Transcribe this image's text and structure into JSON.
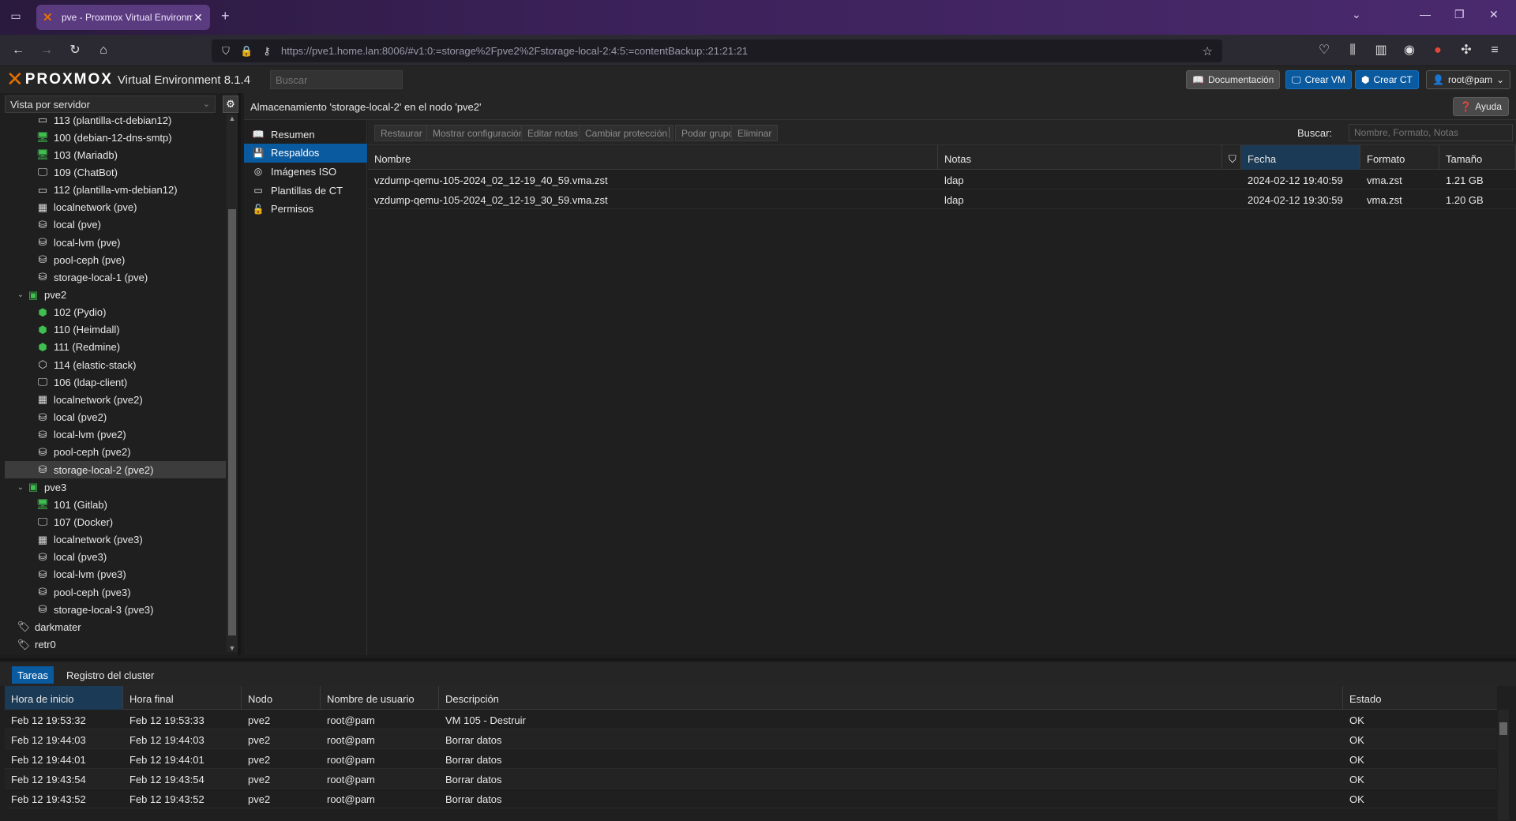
{
  "browser": {
    "tab_title": "pve - Proxmox Virtual Environment",
    "url": "https://pve1.home.lan:8006/#v1:0:=storage%2Fpve2%2Fstorage-local-2:4:5:=contentBackup::21:21:21"
  },
  "pve": {
    "brand": "PROXMOX",
    "version": "Virtual Environment 8.1.4",
    "search_placeholder": "Buscar",
    "docs": "Documentación",
    "create_vm": "Crear VM",
    "create_ct": "Crear CT",
    "user": "root@pam"
  },
  "tree": {
    "view": "Vista por servidor",
    "nodes": [
      {
        "label": "113 (plantilla-ct-debian12)",
        "icon": "template-icon",
        "sym": "▭",
        "indent": 2
      },
      {
        "label": "100 (debian-12-dns-smtp)",
        "icon": "vm-running-icon",
        "sym": "🖥",
        "indent": 2
      },
      {
        "label": "103 (Mariadb)",
        "icon": "vm-running-icon",
        "sym": "🖥",
        "indent": 2
      },
      {
        "label": "109 (ChatBot)",
        "icon": "vm-stopped-icon",
        "sym": "🖵",
        "indent": 2
      },
      {
        "label": "112 (plantilla-vm-debian12)",
        "icon": "template-icon",
        "sym": "▭",
        "indent": 2
      },
      {
        "label": "localnetwork (pve)",
        "icon": "network-grid-icon",
        "sym": "▦",
        "indent": 2
      },
      {
        "label": "local (pve)",
        "icon": "storage-icon",
        "sym": "⛁",
        "indent": 2
      },
      {
        "label": "local-lvm (pve)",
        "icon": "storage-icon",
        "sym": "⛁",
        "indent": 2
      },
      {
        "label": "pool-ceph (pve)",
        "icon": "storage-icon",
        "sym": "⛁",
        "indent": 2
      },
      {
        "label": "storage-local-1 (pve)",
        "icon": "storage-icon",
        "sym": "⛁",
        "indent": 2
      },
      {
        "label": "pve2",
        "icon": "node-online-icon",
        "sym": "▣",
        "indent": 1,
        "exp": "⌄"
      },
      {
        "label": "102 (Pydio)",
        "icon": "container-running-icon",
        "sym": "⬢",
        "indent": 2
      },
      {
        "label": "110 (Heimdall)",
        "icon": "container-running-icon",
        "sym": "⬢",
        "indent": 2
      },
      {
        "label": "111 (Redmine)",
        "icon": "container-running-icon",
        "sym": "⬢",
        "indent": 2
      },
      {
        "label": "114 (elastic-stack)",
        "icon": "container-stopped-icon",
        "sym": "⬡",
        "indent": 2
      },
      {
        "label": "106 (ldap-client)",
        "icon": "vm-stopped-icon",
        "sym": "🖵",
        "indent": 2
      },
      {
        "label": "localnetwork (pve2)",
        "icon": "network-grid-icon",
        "sym": "▦",
        "indent": 2
      },
      {
        "label": "local (pve2)",
        "icon": "storage-icon",
        "sym": "⛁",
        "indent": 2
      },
      {
        "label": "local-lvm (pve2)",
        "icon": "storage-icon",
        "sym": "⛁",
        "indent": 2
      },
      {
        "label": "pool-ceph (pve2)",
        "icon": "storage-icon",
        "sym": "⛁",
        "indent": 2
      },
      {
        "label": "storage-local-2 (pve2)",
        "icon": "storage-icon",
        "sym": "⛁",
        "indent": 2,
        "selected": true
      },
      {
        "label": "pve3",
        "icon": "node-online-icon",
        "sym": "▣",
        "indent": 1,
        "exp": "⌄"
      },
      {
        "label": "101 (Gitlab)",
        "icon": "vm-running-icon",
        "sym": "🖥",
        "indent": 2
      },
      {
        "label": "107 (Docker)",
        "icon": "vm-stopped-icon",
        "sym": "🖵",
        "indent": 2
      },
      {
        "label": "localnetwork (pve3)",
        "icon": "network-grid-icon",
        "sym": "▦",
        "indent": 2
      },
      {
        "label": "local (pve3)",
        "icon": "storage-icon",
        "sym": "⛁",
        "indent": 2
      },
      {
        "label": "local-lvm (pve3)",
        "icon": "storage-icon",
        "sym": "⛁",
        "indent": 2
      },
      {
        "label": "pool-ceph (pve3)",
        "icon": "storage-icon",
        "sym": "⛁",
        "indent": 2
      },
      {
        "label": "storage-local-3 (pve3)",
        "icon": "storage-icon",
        "sym": "⛁",
        "indent": 2
      },
      {
        "label": "darkmater",
        "icon": "tag-icon",
        "sym": "🏷",
        "indent": 1
      },
      {
        "label": "retr0",
        "icon": "tag-icon",
        "sym": "🏷",
        "indent": 1
      }
    ]
  },
  "main": {
    "title": "Almacenamiento 'storage-local-2' en el nodo 'pve2'",
    "help": "Ayuda",
    "submenu": [
      {
        "label": "Resumen",
        "icon": "book-icon",
        "sym": "📖"
      },
      {
        "label": "Respaldos",
        "icon": "floppy-icon",
        "sym": "💾",
        "selected": true
      },
      {
        "label": "Imágenes ISO",
        "icon": "disc-icon",
        "sym": "◎"
      },
      {
        "label": "Plantillas de CT",
        "icon": "template-icon",
        "sym": "▭"
      },
      {
        "label": "Permisos",
        "icon": "unlock-icon",
        "sym": "🔓"
      }
    ],
    "toolbar": {
      "restore": "Restaurar",
      "show_config": "Mostrar configuración",
      "edit_notes": "Editar notas",
      "change_protection": "Cambiar protección",
      "prune": "Podar grupo",
      "delete": "Eliminar",
      "search_label": "Buscar:",
      "search_placeholder": "Nombre, Formato, Notas"
    },
    "columns": {
      "name": "Nombre",
      "notes": "Notas",
      "date": "Fecha",
      "format": "Formato",
      "size": "Tamaño"
    },
    "rows": [
      {
        "name": "vzdump-qemu-105-2024_02_12-19_40_59.vma.zst",
        "notes": "ldap",
        "date": "2024-02-12 19:40:59",
        "format": "vma.zst",
        "size": "1.21 GB"
      },
      {
        "name": "vzdump-qemu-105-2024_02_12-19_30_59.vma.zst",
        "notes": "ldap",
        "date": "2024-02-12 19:30:59",
        "format": "vma.zst",
        "size": "1.20 GB"
      }
    ]
  },
  "tasks": {
    "tab_tasks": "Tareas",
    "tab_log": "Registro del cluster",
    "columns": {
      "start": "Hora de inicio",
      "end": "Hora final",
      "node": "Nodo",
      "user": "Nombre de usuario",
      "desc": "Descripción",
      "status": "Estado"
    },
    "rows": [
      {
        "start": "Feb 12 19:53:32",
        "end": "Feb 12 19:53:33",
        "node": "pve2",
        "user": "root@pam",
        "desc": "VM 105 - Destruir",
        "status": "OK"
      },
      {
        "start": "Feb 12 19:44:03",
        "end": "Feb 12 19:44:03",
        "node": "pve2",
        "user": "root@pam",
        "desc": "Borrar datos",
        "status": "OK"
      },
      {
        "start": "Feb 12 19:44:01",
        "end": "Feb 12 19:44:01",
        "node": "pve2",
        "user": "root@pam",
        "desc": "Borrar datos",
        "status": "OK"
      },
      {
        "start": "Feb 12 19:43:54",
        "end": "Feb 12 19:43:54",
        "node": "pve2",
        "user": "root@pam",
        "desc": "Borrar datos",
        "status": "OK"
      },
      {
        "start": "Feb 12 19:43:52",
        "end": "Feb 12 19:43:52",
        "node": "pve2",
        "user": "root@pam",
        "desc": "Borrar datos",
        "status": "OK"
      }
    ]
  }
}
